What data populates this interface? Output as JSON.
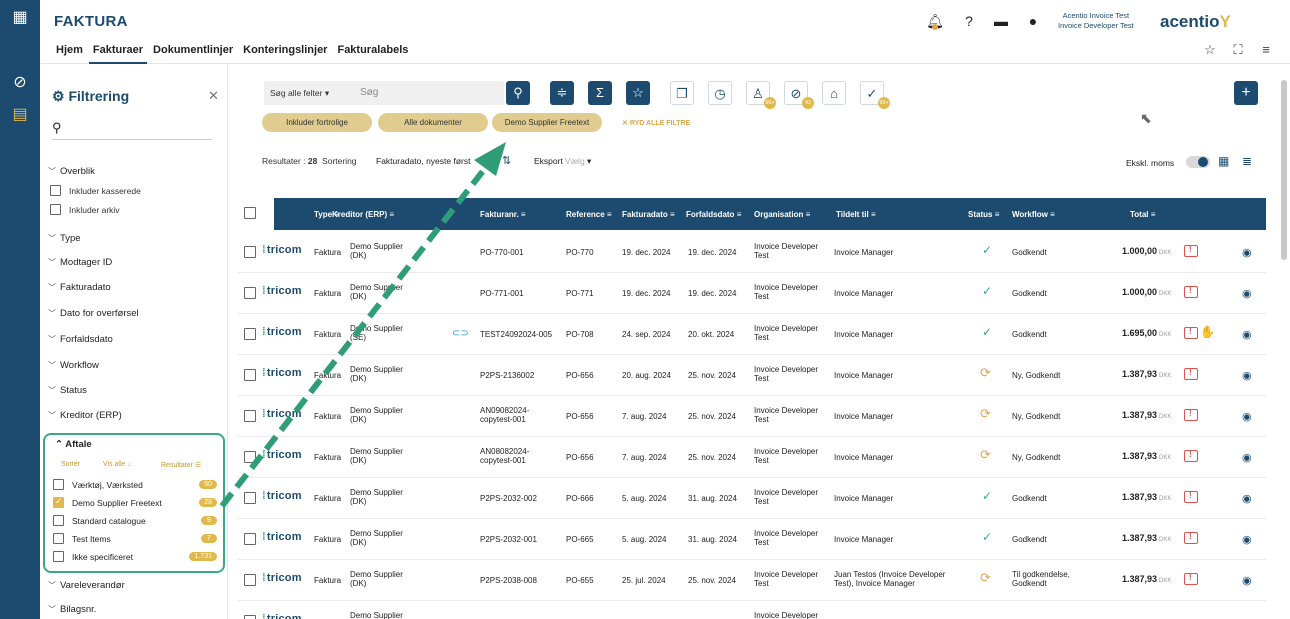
{
  "app": {
    "title": "FAKTURA",
    "brand": "acentio",
    "brand_mark": "Y",
    "user_line1": "Acentio Invoice Test",
    "user_line2": "Invoice Developer Test"
  },
  "nav": [
    {
      "label": "Hjem",
      "active": false
    },
    {
      "label": "Fakturaer",
      "active": true
    },
    {
      "label": "Dokumentlinjer",
      "active": false
    },
    {
      "label": "Konteringslinjer",
      "active": false
    },
    {
      "label": "Fakturalabels",
      "active": false
    }
  ],
  "filter": {
    "title": "Filtrering",
    "sections": [
      "Overblik",
      "Type",
      "Modtager ID",
      "Fakturadato",
      "Dato for overførsel",
      "Forfaldsdato",
      "Workflow",
      "Status",
      "Kreditor (ERP)"
    ],
    "overblik_options": [
      "Inkluder kasserede",
      "Inkluder arkiv"
    ],
    "aftale": {
      "title": "Aftale",
      "sort_label": "Sortér",
      "show_all_label": "Vis alle",
      "results_label": "Resultater",
      "options": [
        {
          "label": "Værktøj, Værksted",
          "count": "50",
          "checked": false
        },
        {
          "label": "Demo Supplier Freetext",
          "count": "28",
          "checked": true
        },
        {
          "label": "Standard catalogue",
          "count": "9",
          "checked": false
        },
        {
          "label": "Test Items",
          "count": "7",
          "checked": false
        },
        {
          "label": "Ikke specificeret",
          "count": "1.731",
          "checked": false
        }
      ]
    },
    "after_sections": [
      "Vareleverandør",
      "Bilagsnr."
    ]
  },
  "toolbar": {
    "search_scope": "Søg alle felter",
    "search_placeholder": "Søg",
    "badges": [
      "99+",
      "42",
      "99+"
    ]
  },
  "chips": [
    "Inkluder fortrolige",
    "Alle dokumenter",
    "Demo Supplier Freetext"
  ],
  "clear_filters": "RYD ALLE FILTRE",
  "results": {
    "label": "Resultater :",
    "count": "28",
    "sort_label": "Sortering",
    "sort_value": "Fakturadato, nyeste først",
    "export_label": "Eksport",
    "export_value": "Vælg",
    "moms_label": "Ekskl. moms"
  },
  "table": {
    "headers": [
      "Type",
      "Kreditor (ERP)",
      "Fakturanr.",
      "Reference",
      "Fakturadato",
      "Forfaldsdato",
      "Organisation",
      "Tildelt til",
      "Status",
      "Workflow",
      "Total"
    ],
    "logo_text": "tricom",
    "currency": "DKK",
    "rows": [
      {
        "type": "Faktura",
        "kreditor1": "Demo Supplier",
        "kreditor2": "(DK)",
        "fakturanr1": "PO-770-001",
        "fakturanr2": "",
        "reference": "PO-770",
        "fakturadato": "19. dec. 2024",
        "forfaldsdato": "19. dec. 2024",
        "org1": "Invoice Developer",
        "org2": "Test",
        "tildelt1": "Invoice Manager",
        "tildelt2": "",
        "status": "ok",
        "workflow1": "Godkendt",
        "workflow2": "",
        "total": "1.000,00",
        "hand": false,
        "clip": false
      },
      {
        "type": "Faktura",
        "kreditor1": "Demo Supplier",
        "kreditor2": "(DK)",
        "fakturanr1": "PO-771-001",
        "fakturanr2": "",
        "reference": "PO-771",
        "fakturadato": "19. dec. 2024",
        "forfaldsdato": "19. dec. 2024",
        "org1": "Invoice Developer",
        "org2": "Test",
        "tildelt1": "Invoice Manager",
        "tildelt2": "",
        "status": "ok",
        "workflow1": "Godkendt",
        "workflow2": "",
        "total": "1.000,00",
        "hand": false,
        "clip": false
      },
      {
        "type": "Faktura",
        "kreditor1": "Demo Supplier",
        "kreditor2": "(SE)",
        "fakturanr1": "TEST24092024-005",
        "fakturanr2": "",
        "reference": "PO-708",
        "fakturadato": "24. sep. 2024",
        "forfaldsdato": "20. okt. 2024",
        "org1": "Invoice Developer",
        "org2": "Test",
        "tildelt1": "Invoice Manager",
        "tildelt2": "",
        "status": "ok",
        "workflow1": "Godkendt",
        "workflow2": "",
        "total": "1.695,00",
        "hand": true,
        "clip": true
      },
      {
        "type": "Faktura",
        "kreditor1": "Demo Supplier",
        "kreditor2": "(DK)",
        "fakturanr1": "P2PS-2136002",
        "fakturanr2": "",
        "reference": "PO-656",
        "fakturadato": "20. aug. 2024",
        "forfaldsdato": "25. nov. 2024",
        "org1": "Invoice Developer",
        "org2": "Test",
        "tildelt1": "Invoice Manager",
        "tildelt2": "",
        "status": "sync",
        "workflow1": "Ny, Godkendt",
        "workflow2": "",
        "total": "1.387,93",
        "hand": false,
        "clip": false
      },
      {
        "type": "Faktura",
        "kreditor1": "Demo Supplier",
        "kreditor2": "(DK)",
        "fakturanr1": "AN09082024-",
        "fakturanr2": "copytest-001",
        "reference": "PO-656",
        "fakturadato": "7. aug. 2024",
        "forfaldsdato": "25. nov. 2024",
        "org1": "Invoice Developer",
        "org2": "Test",
        "tildelt1": "Invoice Manager",
        "tildelt2": "",
        "status": "sync",
        "workflow1": "Ny, Godkendt",
        "workflow2": "",
        "total": "1.387,93",
        "hand": false,
        "clip": false
      },
      {
        "type": "Faktura",
        "kreditor1": "Demo Supplier",
        "kreditor2": "(DK)",
        "fakturanr1": "AN08082024-",
        "fakturanr2": "copytest-001",
        "reference": "PO-656",
        "fakturadato": "7. aug. 2024",
        "forfaldsdato": "25. nov. 2024",
        "org1": "Invoice Developer",
        "org2": "Test",
        "tildelt1": "Invoice Manager",
        "tildelt2": "",
        "status": "sync",
        "workflow1": "Ny, Godkendt",
        "workflow2": "",
        "total": "1.387,93",
        "hand": false,
        "clip": false
      },
      {
        "type": "Faktura",
        "kreditor1": "Demo Supplier",
        "kreditor2": "(DK)",
        "fakturanr1": "P2PS-2032-002",
        "fakturanr2": "",
        "reference": "PO-666",
        "fakturadato": "5. aug. 2024",
        "forfaldsdato": "31. aug. 2024",
        "org1": "Invoice Developer",
        "org2": "Test",
        "tildelt1": "Invoice Manager",
        "tildelt2": "",
        "status": "ok",
        "workflow1": "Godkendt",
        "workflow2": "",
        "total": "1.387,93",
        "hand": false,
        "clip": false
      },
      {
        "type": "Faktura",
        "kreditor1": "Demo Supplier",
        "kreditor2": "(DK)",
        "fakturanr1": "P2PS-2032-001",
        "fakturanr2": "",
        "reference": "PO-665",
        "fakturadato": "5. aug. 2024",
        "forfaldsdato": "31. aug. 2024",
        "org1": "Invoice Developer",
        "org2": "Test",
        "tildelt1": "Invoice Manager",
        "tildelt2": "",
        "status": "ok",
        "workflow1": "Godkendt",
        "workflow2": "",
        "total": "1.387,93",
        "hand": false,
        "clip": false
      },
      {
        "type": "Faktura",
        "kreditor1": "Demo Supplier",
        "kreditor2": "(DK)",
        "fakturanr1": "P2PS-2038-008",
        "fakturanr2": "",
        "reference": "PO-655",
        "fakturadato": "25. jul. 2024",
        "forfaldsdato": "25. nov. 2024",
        "org1": "Invoice Developer",
        "org2": "Test",
        "tildelt1": "Juan Testos (Invoice Developer",
        "tildelt2": "Test), Invoice Manager",
        "status": "sync",
        "workflow1": "Til godkendelse,",
        "workflow2": "Godkendt",
        "total": "1.387,93",
        "hand": false,
        "clip": false
      },
      {
        "type": "",
        "kreditor1": "Demo Supplier",
        "kreditor2": "",
        "fakturanr1": "",
        "fakturanr2": "",
        "reference": "",
        "fakturadato": "",
        "forfaldsdato": "",
        "org1": "Invoice Developer",
        "org2": "",
        "tildelt1": "",
        "tildelt2": "",
        "status": "",
        "workflow1": "",
        "workflow2": "",
        "total": "",
        "hand": false,
        "clip": false
      }
    ]
  },
  "colors": {
    "primary": "#1c4b6f",
    "accent": "#e0b84b",
    "highlight": "#3aa985",
    "alert": "#d9534f"
  }
}
